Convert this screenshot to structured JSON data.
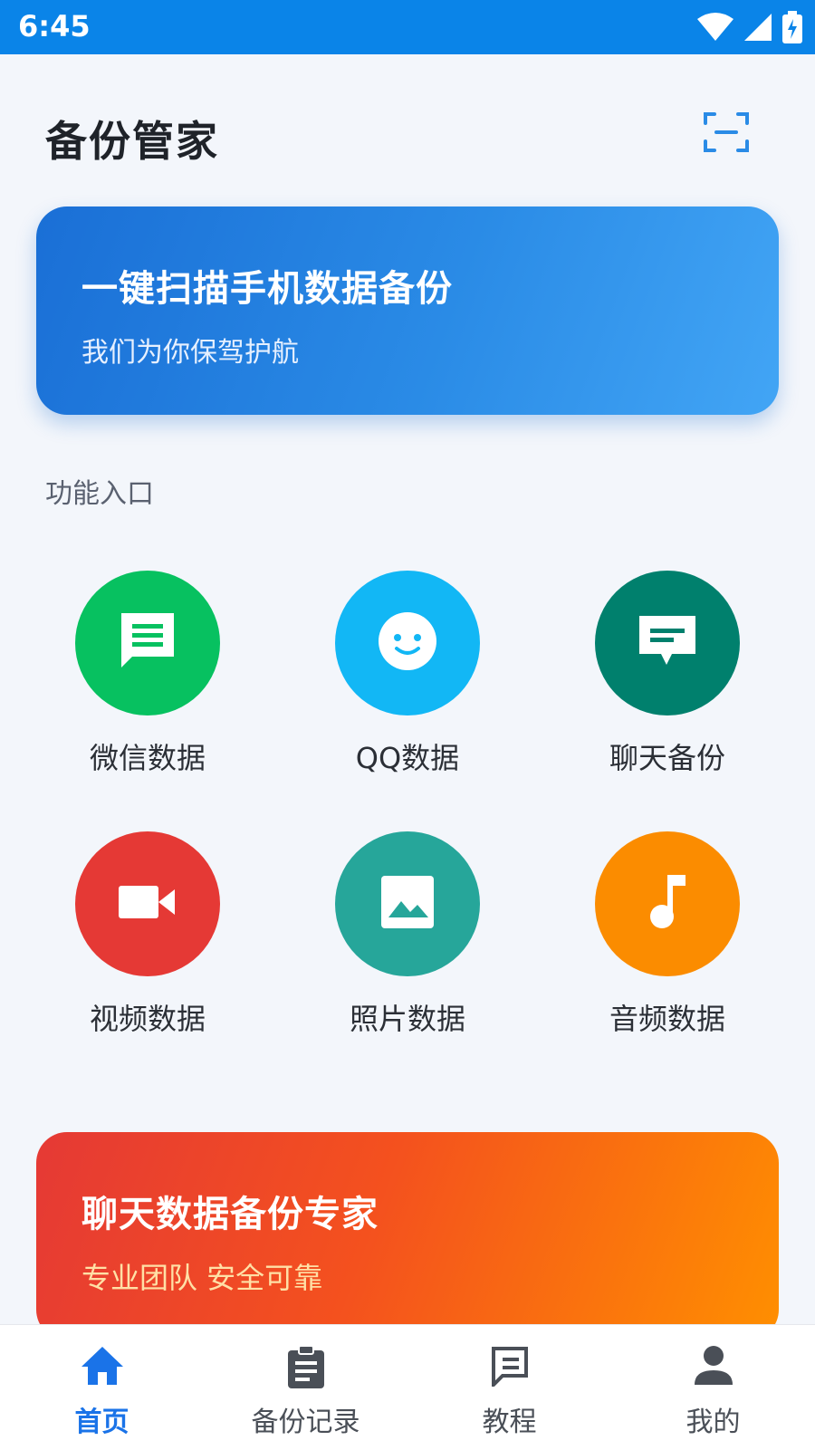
{
  "status_bar": {
    "time": "6:45",
    "icons": [
      "wifi-icon",
      "signal-icon",
      "battery-charging-icon"
    ]
  },
  "header": {
    "title": "备份管家",
    "scan_icon": "scan-icon"
  },
  "hero": {
    "title": "一键扫描手机数据备份",
    "subtitle": "我们为你保驾护航"
  },
  "section": {
    "label": "功能入口"
  },
  "features": [
    {
      "label": "微信数据",
      "icon": "chat-lines-icon",
      "color": "#07c160"
    },
    {
      "label": "QQ数据",
      "icon": "smiley-icon",
      "color": "#12b7f5"
    },
    {
      "label": "聊天备份",
      "icon": "message-icon",
      "color": "#00806d"
    },
    {
      "label": "视频数据",
      "icon": "video-camera-icon",
      "color": "#e53935"
    },
    {
      "label": "照片数据",
      "icon": "image-icon",
      "color": "#26a69a"
    },
    {
      "label": "音频数据",
      "icon": "music-note-icon",
      "color": "#fb8c00"
    }
  ],
  "promo": {
    "title": "聊天数据备份专家",
    "subtitle": "专业团队 安全可靠"
  },
  "bottom_nav": [
    {
      "label": "首页",
      "icon": "home-icon",
      "active": true
    },
    {
      "label": "备份记录",
      "icon": "clipboard-icon",
      "active": false
    },
    {
      "label": "教程",
      "icon": "tutorial-icon",
      "active": false
    },
    {
      "label": "我的",
      "icon": "person-icon",
      "active": false
    }
  ],
  "colors": {
    "accent": "#1a73e8",
    "status_bar": "#0a84e8",
    "background": "#f3f6fb"
  }
}
